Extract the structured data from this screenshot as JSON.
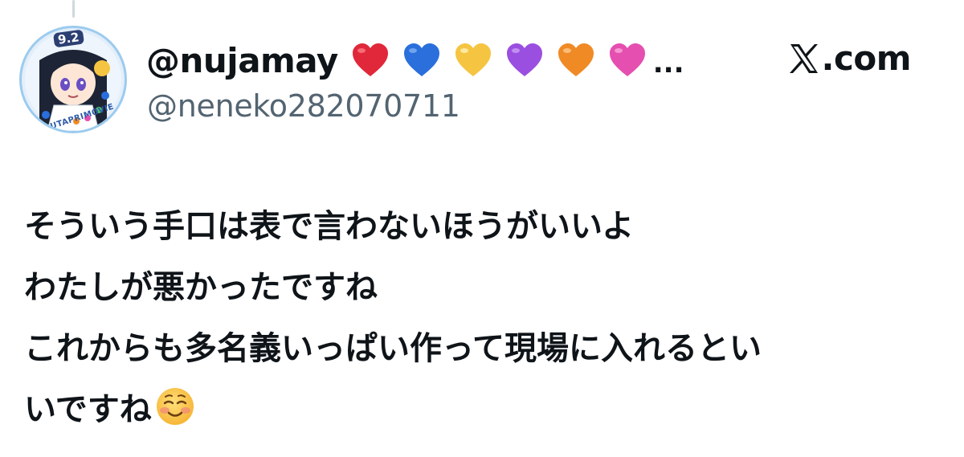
{
  "header": {
    "display_name": "@nujamay",
    "display_name_emoji": [
      "red-heart",
      "blue-heart",
      "yellow-heart",
      "purple-heart",
      "orange-heart",
      "pink-heart"
    ],
    "truncation": "...",
    "handle": "@neneko282070711",
    "site": ".com"
  },
  "avatar": {
    "badge_text": "9.2",
    "ring_text": "UTAPRIMOVIE"
  },
  "tweet": {
    "lines": [
      "そういう手口は表で言わないほうがいいよ",
      "わたしが悪かったですね",
      "これからも多名義いっぱい作って現場に入れるとい",
      "いですね"
    ],
    "trailing_emoji": "smiling-face-with-blush"
  },
  "colors": {
    "text": "#0f1419",
    "secondary": "#536471",
    "red": "#e0283a",
    "blue": "#2a6fdb",
    "yellow": "#f5c542",
    "purple": "#9b4fe0",
    "orange": "#f08a24",
    "pink": "#e54fb0"
  }
}
